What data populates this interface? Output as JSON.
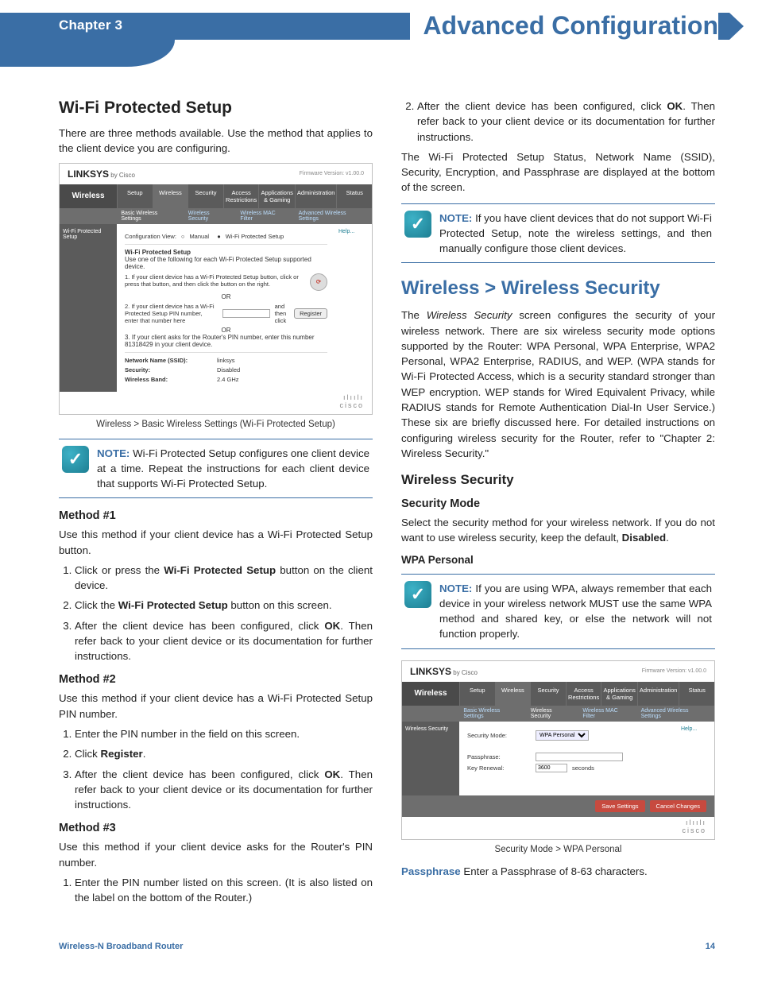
{
  "header": {
    "chapter": "Chapter 3",
    "title": "Advanced Configuration"
  },
  "footer": {
    "product": "Wireless-N Broadband Router",
    "page": "14"
  },
  "left": {
    "h_wps": "Wi-Fi Protected Setup",
    "intro": "There are three methods available. Use the method that applies to the client device you are configuring.",
    "fig1_caption": "Wireless > Basic Wireless Settings (Wi-Fi Protected Setup)",
    "note1": {
      "label": "NOTE:",
      "text": " Wi-Fi Protected Setup configures one client device at a time. Repeat the instructions for each client device that supports Wi-Fi Protected Setup."
    },
    "m1_h": "Method #1",
    "m1_p": "Use this method if your client device has a Wi-Fi Protected Setup button.",
    "m1_li1a": "Click or press the ",
    "m1_li1b": "Wi-Fi Protected Setup",
    "m1_li1c": " button on the client device.",
    "m1_li2a": "Click the ",
    "m1_li2b": "Wi-Fi Protected Setup",
    "m1_li2c": " button on this screen.",
    "m1_li3a": "After the client device has been configured, click ",
    "m1_li3b": "OK",
    "m1_li3c": ". Then refer back to your client device or its documentation for further instructions.",
    "m2_h": "Method #2",
    "m2_p": "Use this method if your client device has a Wi-Fi Protected Setup PIN number.",
    "m2_li1": "Enter the PIN number in the field on this screen.",
    "m2_li2a": "Click ",
    "m2_li2b": "Register",
    "m2_li2c": ".",
    "m2_li3a": "After the client device has been configured, click ",
    "m2_li3b": "OK",
    "m2_li3c": ". Then refer back to your client device or its documentation for further instructions.",
    "m3_h": "Method #3",
    "m3_p": "Use this method if your client device asks for the Router's PIN number.",
    "m3_li1": "Enter the PIN number listed on this screen. (It is also listed on the label on the bottom of the Router.)"
  },
  "right": {
    "cont_li2a": "After the client device has been configured, click ",
    "cont_li2b": "OK",
    "cont_li2c": ". Then refer back to your client device or its documentation for further instructions.",
    "para1": "The Wi-Fi Protected Setup Status, Network Name (SSID), Security, Encryption, and Passphrase are displayed at the bottom of the screen.",
    "note2": {
      "label": "NOTE:",
      "text": " If you have client devices that do not support Wi-Fi Protected Setup, note the wireless settings, and then manually configure those client devices."
    },
    "h_sec": "Wireless > Wireless Security",
    "sec_p1a": "The ",
    "sec_p1b": "Wireless Security",
    "sec_p1c": " screen configures the security of your wireless network. There are six wireless security mode options supported by the Router: WPA Personal, WPA Enterprise, WPA2 Personal, WPA2 Enterprise, RADIUS, and WEP. (WPA stands for Wi-Fi Protected Access, which is a security standard stronger than WEP encryption. WEP stands for Wired Equivalent Privacy, while RADIUS stands for Remote Authentication Dial-In User Service.) These six are briefly discussed here. For detailed instructions on configuring wireless security for the Router, refer to \"Chapter 2: Wireless Security.\"",
    "h_ws": "Wireless Security",
    "h_mode": "Security Mode",
    "mode_p_a": "Select the security method for your wireless network. If you do not want to use wireless security, keep the default, ",
    "mode_p_b": "Disabled",
    "mode_p_c": ".",
    "h_wpa": "WPA Personal",
    "note3": {
      "label": "NOTE:",
      "text": " If you are using WPA, always remember that each device in your wireless network MUST use the same WPA method and shared key, or else the network will not function properly."
    },
    "fig2_caption": "Security Mode > WPA Personal",
    "pass_label": "Passphrase",
    "pass_text": "  Enter a Passphrase of 8-63 characters."
  },
  "router_common": {
    "brand": "LINKSYS",
    "bycisco": " by Cisco",
    "fw": "Firmware Version: v1.00.0",
    "section": "Wireless",
    "tabs": [
      "Setup",
      "Wireless",
      "Security",
      "Access Restrictions",
      "Applications & Gaming",
      "Administration",
      "Status"
    ],
    "help": "Help...",
    "cisco": "cisco"
  },
  "router1": {
    "sidelabel": "Wi-Fi Protected Setup",
    "subtabs": [
      "Basic Wireless Settings",
      "Wireless Security",
      "Wireless MAC Filter",
      "Advanced Wireless Settings"
    ],
    "cfgview": "Configuration View:",
    "opt_manual": "Manual",
    "opt_wps": "Wi-Fi Protected Setup",
    "h": "Wi-Fi Protected Setup",
    "instr": "Use one of the following for each Wi-Fi Protected Setup supported device.",
    "s1": "1. If your client device has a Wi-Fi Protected Setup button, click or press that button, and then click the button on the right.",
    "or": "OR",
    "s2": "2. If your client device has a Wi-Fi Protected Setup PIN number, enter that number here",
    "reg": "Register",
    "s3": "3. If your client asks for the Router's PIN number, enter this number 81318429 in your client device.",
    "k1": "Network Name (SSID):",
    "v1": "linksys",
    "k2": "Security:",
    "v2": "Disabled",
    "k3": "Wireless Band:",
    "v3": "2.4 GHz"
  },
  "router2": {
    "sidelabel": "Wireless Security",
    "subtabs": [
      "Basic Wireless Settings",
      "Wireless Security",
      "Wireless MAC Filter",
      "Advanced Wireless Settings"
    ],
    "k_mode": "Security Mode:",
    "v_mode": "WPA Personal",
    "k_pass": "Passphrase:",
    "k_renew": "Key Renewal:",
    "v_renew": "3600",
    "u_renew": "seconds",
    "btn_save": "Save Settings",
    "btn_cancel": "Cancel Changes"
  }
}
